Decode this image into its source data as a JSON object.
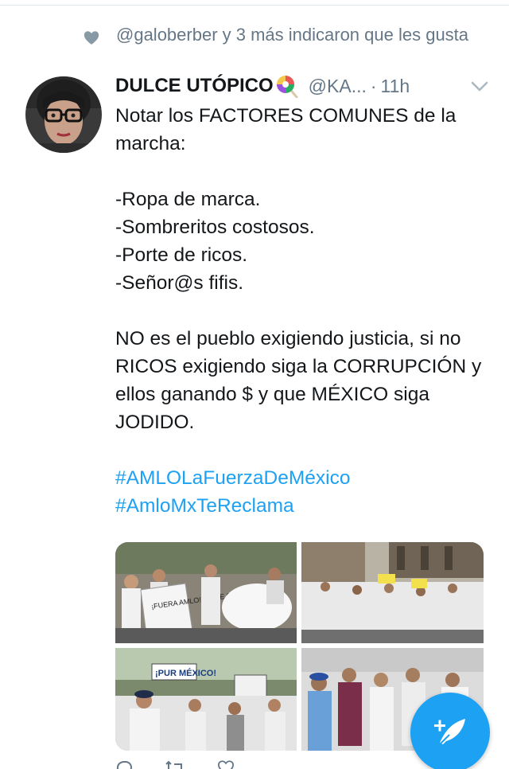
{
  "social_context": {
    "text": "@galoberber y 3 más indicaron que les gusta",
    "icon": "heart-icon"
  },
  "tweet": {
    "display_name": "DULCE UTÓPICO",
    "name_emoji": "lollipop",
    "handle": "@KA...",
    "separator": "·",
    "time": "11h",
    "lines": {
      "l1": "Notar los FACTORES COMUNES de la marcha:",
      "l2": "-Ropa de marca.",
      "l3": "-Sombreritos costosos.",
      "l4": "-Porte de ricos.",
      "l5": "-Señor@s fifis.",
      "l6": "NO es el pueblo exigiendo justicia, si no RICOS exigiendo siga la CORRUPCIÓN y ellos ganando $ y que MÉXICO siga JODIDO."
    },
    "hashtags": [
      "#AMLOLaFuerzaDeMéxico",
      "#AmloMxTeReclama"
    ],
    "photo_sign_1": "¡FUERA AMLO! NO TE QUEREMOS",
    "photo_sign_2": "¡PUR MÉXICO!"
  },
  "colors": {
    "accent": "#1da1f2",
    "text": "#14171a",
    "muted": "#657786"
  }
}
